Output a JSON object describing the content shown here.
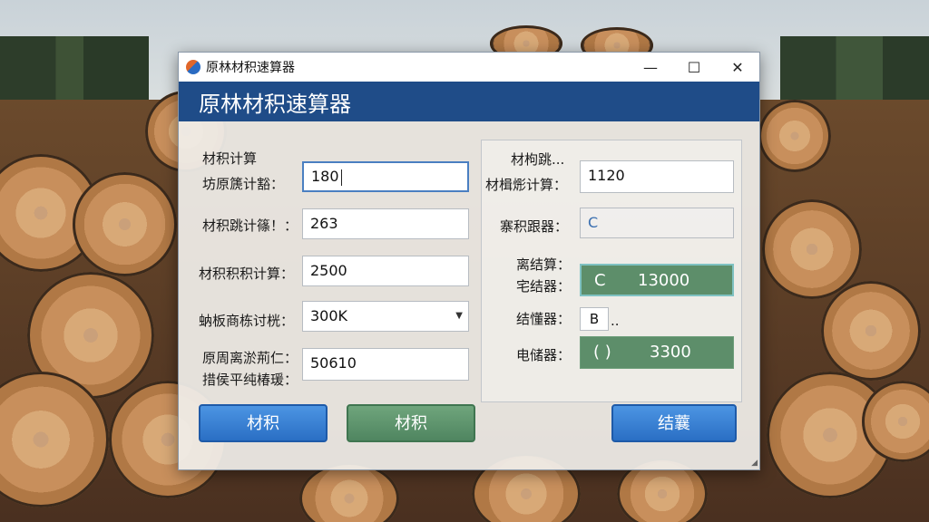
{
  "window": {
    "title": "原林材积速算器",
    "minimize_glyph": "—",
    "maximize_glyph": "☐",
    "close_glyph": "✕",
    "header_title": "原林材积速算器"
  },
  "left": {
    "section_label": "材积计算",
    "row1_label": "坊原篪计豁：",
    "row1_value": "180",
    "row2_label": "材积跳计篠！：",
    "row2_value": "263",
    "row3_label": "材积积积计算：",
    "row3_value": "2500",
    "row4_label": "蚋板商栋讨桄：",
    "row4_value": "300K",
    "row5_label_a": "原周离淤荊仁：",
    "row5_label_b": "措侯平纯椿瑗：",
    "row5_value": "50610"
  },
  "right": {
    "label1_a": "材枸跳...",
    "label1_b": "材楫烿计算：",
    "value1": "1120",
    "label2": "寨积跟器：",
    "value2": "C",
    "label3_a": "离结算：",
    "label3_b": "宅结器：",
    "result3_prefix": "C",
    "result3_value": "13000",
    "label4": "结懂器：",
    "value4_box": "B",
    "value4_dots": "..",
    "label5": "电储器：",
    "result5_prefix": "( )",
    "result5_value": "3300"
  },
  "buttons": {
    "btn1": "材积",
    "btn2": "材积",
    "btn3": "结蘘"
  },
  "colors": {
    "header": "#1f4c88",
    "result_green": "#5d8e6a",
    "button_blue": "#2a6fc4"
  }
}
